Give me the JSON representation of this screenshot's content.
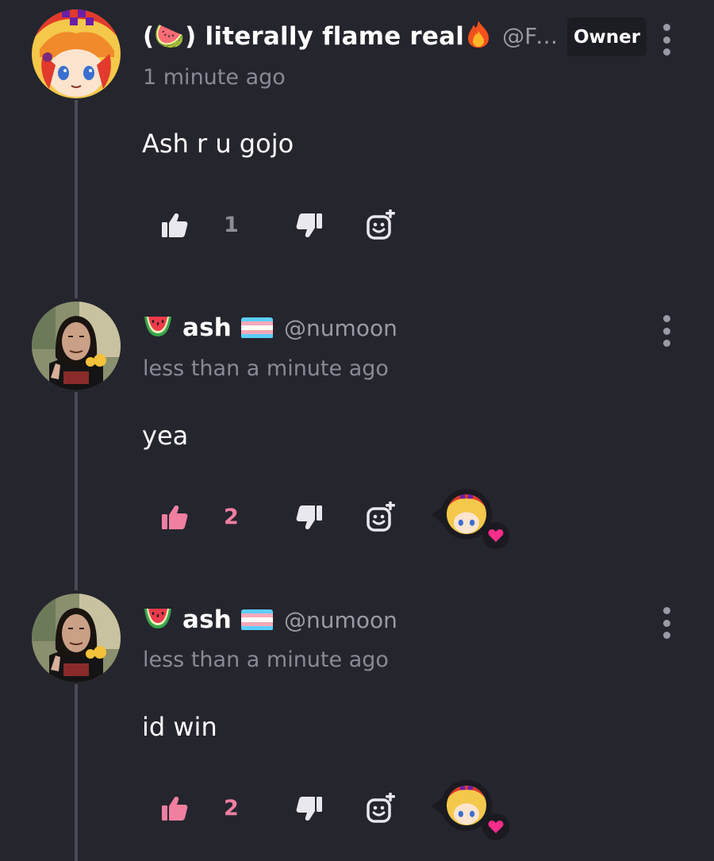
{
  "colors": {
    "background": "#25252e",
    "like_active": "#f07fa0",
    "like_inactive": "#e8e8ee",
    "heart": "#ff2d8a",
    "muted_text": "#8a8a96"
  },
  "comments": [
    {
      "name": "(🍉) literally flame real",
      "name_emoji": "🔥",
      "handle": "@Fre…",
      "badge": "Owner",
      "timestamp": "1 minute ago",
      "text": "Ash r u gojo",
      "likes": "1",
      "liked": false,
      "reaction_shown": false,
      "avatar_icon": "anime-avatar"
    },
    {
      "name": "ash",
      "name_prefix_emoji": "🍉",
      "handle": "@numoon",
      "flag": "trans-flag",
      "timestamp": "less than a minute ago",
      "text": "yea",
      "likes": "2",
      "liked": true,
      "reaction_shown": true,
      "avatar_icon": "photo-avatar"
    },
    {
      "name": "ash",
      "name_prefix_emoji": "🍉",
      "handle": "@numoon",
      "flag": "trans-flag",
      "timestamp": "less than a minute ago",
      "text": "id win",
      "likes": "2",
      "liked": true,
      "reaction_shown": true,
      "avatar_icon": "photo-avatar"
    }
  ]
}
